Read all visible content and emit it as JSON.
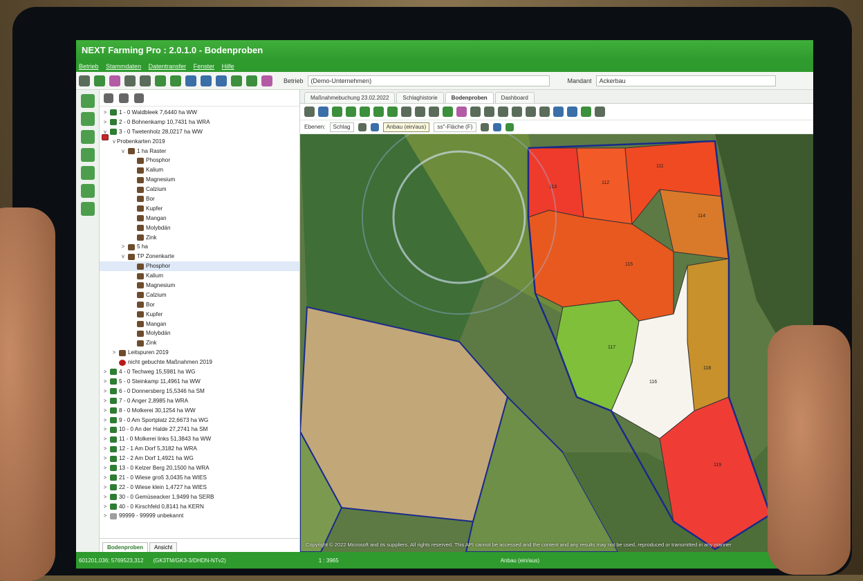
{
  "window": {
    "title": "NEXT Farming Pro : 2.0.1.0  - Bodenproben"
  },
  "menu": [
    "Betrieb",
    "Stammdaten",
    "Datentransfer",
    "Fenster",
    "Hilfe"
  ],
  "toolbar": {
    "betrieb_label": "Betrieb",
    "betrieb_value": "(Demo-Unternehmen)",
    "mandant_label": "Mandant",
    "mandant_value": "Ackerbau"
  },
  "tree": {
    "nodes": [
      {
        "level": 0,
        "toggle": ">",
        "icon": "field",
        "label": "1 - 0 Waldbleek 7,6440 ha WW"
      },
      {
        "level": 0,
        "toggle": ">",
        "icon": "field",
        "label": "2 - 0 Bohnenkamp 10,7431 ha WRA"
      },
      {
        "level": 0,
        "toggle": "v",
        "icon": "field",
        "label": "3 - 0 Twetenholz 28,0217 ha WW"
      },
      {
        "level": 1,
        "toggle": "v",
        "icon": "map",
        "label": "Probenkarten 2019"
      },
      {
        "level": 2,
        "toggle": "v",
        "icon": "layer",
        "label": "1 ha Raster"
      },
      {
        "level": 3,
        "toggle": "",
        "icon": "layer",
        "label": "Phosphor"
      },
      {
        "level": 3,
        "toggle": "",
        "icon": "layer",
        "label": "Kalium"
      },
      {
        "level": 3,
        "toggle": "",
        "icon": "layer",
        "label": "Magnesium"
      },
      {
        "level": 3,
        "toggle": "",
        "icon": "layer",
        "label": "Calzium"
      },
      {
        "level": 3,
        "toggle": "",
        "icon": "layer",
        "label": "Bor"
      },
      {
        "level": 3,
        "toggle": "",
        "icon": "layer",
        "label": "Kupfer"
      },
      {
        "level": 3,
        "toggle": "",
        "icon": "layer",
        "label": "Mangan"
      },
      {
        "level": 3,
        "toggle": "",
        "icon": "layer",
        "label": "Molybdän"
      },
      {
        "level": 3,
        "toggle": "",
        "icon": "layer",
        "label": "Zink"
      },
      {
        "level": 2,
        "toggle": ">",
        "icon": "layer",
        "label": "5 ha"
      },
      {
        "level": 2,
        "toggle": "v",
        "icon": "layer",
        "label": "TP Zonenkarte"
      },
      {
        "level": 3,
        "toggle": "",
        "icon": "layer",
        "label": "Phosphor",
        "selected": true
      },
      {
        "level": 3,
        "toggle": "",
        "icon": "layer",
        "label": "Kalium"
      },
      {
        "level": 3,
        "toggle": "",
        "icon": "layer",
        "label": "Magnesium"
      },
      {
        "level": 3,
        "toggle": "",
        "icon": "layer",
        "label": "Calzium"
      },
      {
        "level": 3,
        "toggle": "",
        "icon": "layer",
        "label": "Bor"
      },
      {
        "level": 3,
        "toggle": "",
        "icon": "layer",
        "label": "Kupfer"
      },
      {
        "level": 3,
        "toggle": "",
        "icon": "layer",
        "label": "Mangan"
      },
      {
        "level": 3,
        "toggle": "",
        "icon": "layer",
        "label": "Molybdän"
      },
      {
        "level": 3,
        "toggle": "",
        "icon": "layer",
        "label": "Zink"
      },
      {
        "level": 1,
        "toggle": ">",
        "icon": "layer",
        "label": "Leitspuren 2019"
      },
      {
        "level": 1,
        "toggle": "",
        "icon": "truck",
        "label": "nicht gebuchte Maßnahmen 2019"
      },
      {
        "level": 0,
        "toggle": ">",
        "icon": "field",
        "label": "4 - 0 Techweg 15,5981 ha WG"
      },
      {
        "level": 0,
        "toggle": ">",
        "icon": "field",
        "label": "5 - 0 Steinkamp 11,4961 ha WW"
      },
      {
        "level": 0,
        "toggle": ">",
        "icon": "field",
        "label": "6 - 0 Donnersberg 15,5346 ha SM"
      },
      {
        "level": 0,
        "toggle": ">",
        "icon": "field",
        "label": "7 - 0 Anger 2,8985 ha WRA"
      },
      {
        "level": 0,
        "toggle": ">",
        "icon": "field",
        "label": "8 - 0 Molkerei 30,1254 ha WW"
      },
      {
        "level": 0,
        "toggle": ">",
        "icon": "field",
        "label": "9 - 0 Am Sportplatz 22,6673 ha WG"
      },
      {
        "level": 0,
        "toggle": ">",
        "icon": "field",
        "label": "10 - 0 An der Halde 27,2741 ha SM"
      },
      {
        "level": 0,
        "toggle": ">",
        "icon": "field",
        "label": "11 - 0 Molkerei links 51,3843 ha WW"
      },
      {
        "level": 0,
        "toggle": ">",
        "icon": "field",
        "label": "12 - 1 Am Dorf 5,3182 ha WRA"
      },
      {
        "level": 0,
        "toggle": ">",
        "icon": "field",
        "label": "12 - 2 Am Dorf 1,4921 ha WG"
      },
      {
        "level": 0,
        "toggle": ">",
        "icon": "field",
        "label": "13 - 0 Kelzer Berg 20,1500 ha WRA"
      },
      {
        "level": 0,
        "toggle": ">",
        "icon": "field",
        "label": "21 - 0 Wiese groß 3,0435 ha WIES"
      },
      {
        "level": 0,
        "toggle": ">",
        "icon": "field",
        "label": "22 - 0 Wiese klein 1,4727 ha WIES"
      },
      {
        "level": 0,
        "toggle": ">",
        "icon": "field",
        "label": "30 - 0 Gemüseacker 1,9499 ha SERB"
      },
      {
        "level": 0,
        "toggle": ">",
        "icon": "field",
        "label": "40 - 0 Kirschfeld 0,8141 ha KERN"
      },
      {
        "level": 0,
        "toggle": ">",
        "icon": "unk",
        "label": "99999 - 99999 unbekannt"
      }
    ],
    "tabs": [
      "Bodenproben",
      "Ansicht"
    ]
  },
  "doc_tabs": [
    "Maßnahmebuchung 23.02.2022",
    "Schlaghistorie",
    "Bodenproben",
    "Dashboard"
  ],
  "layerbar": {
    "label": "Ebenen:",
    "layer": "Schlag",
    "tooltip": "Anbau (ein/aus)",
    "display": "ss\"-Fläche (F)"
  },
  "zones": [
    {
      "id": "113",
      "color": "#ef3b2c"
    },
    {
      "id": "112",
      "color": "#f25a28"
    },
    {
      "id": "111",
      "color": "#f04a23"
    },
    {
      "id": "114",
      "color": "#d97a2a"
    },
    {
      "id": "115",
      "color": "#e8591f"
    },
    {
      "id": "116",
      "color": "#f7f4ee"
    },
    {
      "id": "117",
      "color": "#7fbf3a"
    },
    {
      "id": "118",
      "color": "#c8912c"
    },
    {
      "id": "119",
      "color": "#ef3d35"
    }
  ],
  "map": {
    "copyright": "Copyright © 2022 Microsoft and its suppliers. All rights reserved. This API cannot be accessed and the content and any results may not be used, reproduced or transmitted in any manner"
  },
  "statusbar": {
    "coords": "601201,036; 5769523,312",
    "crs": "(GK3TM/GK3-3/DHDN-NTv2)",
    "scale": "1 : 3965",
    "mode": "Anbau (ein/aus)"
  }
}
